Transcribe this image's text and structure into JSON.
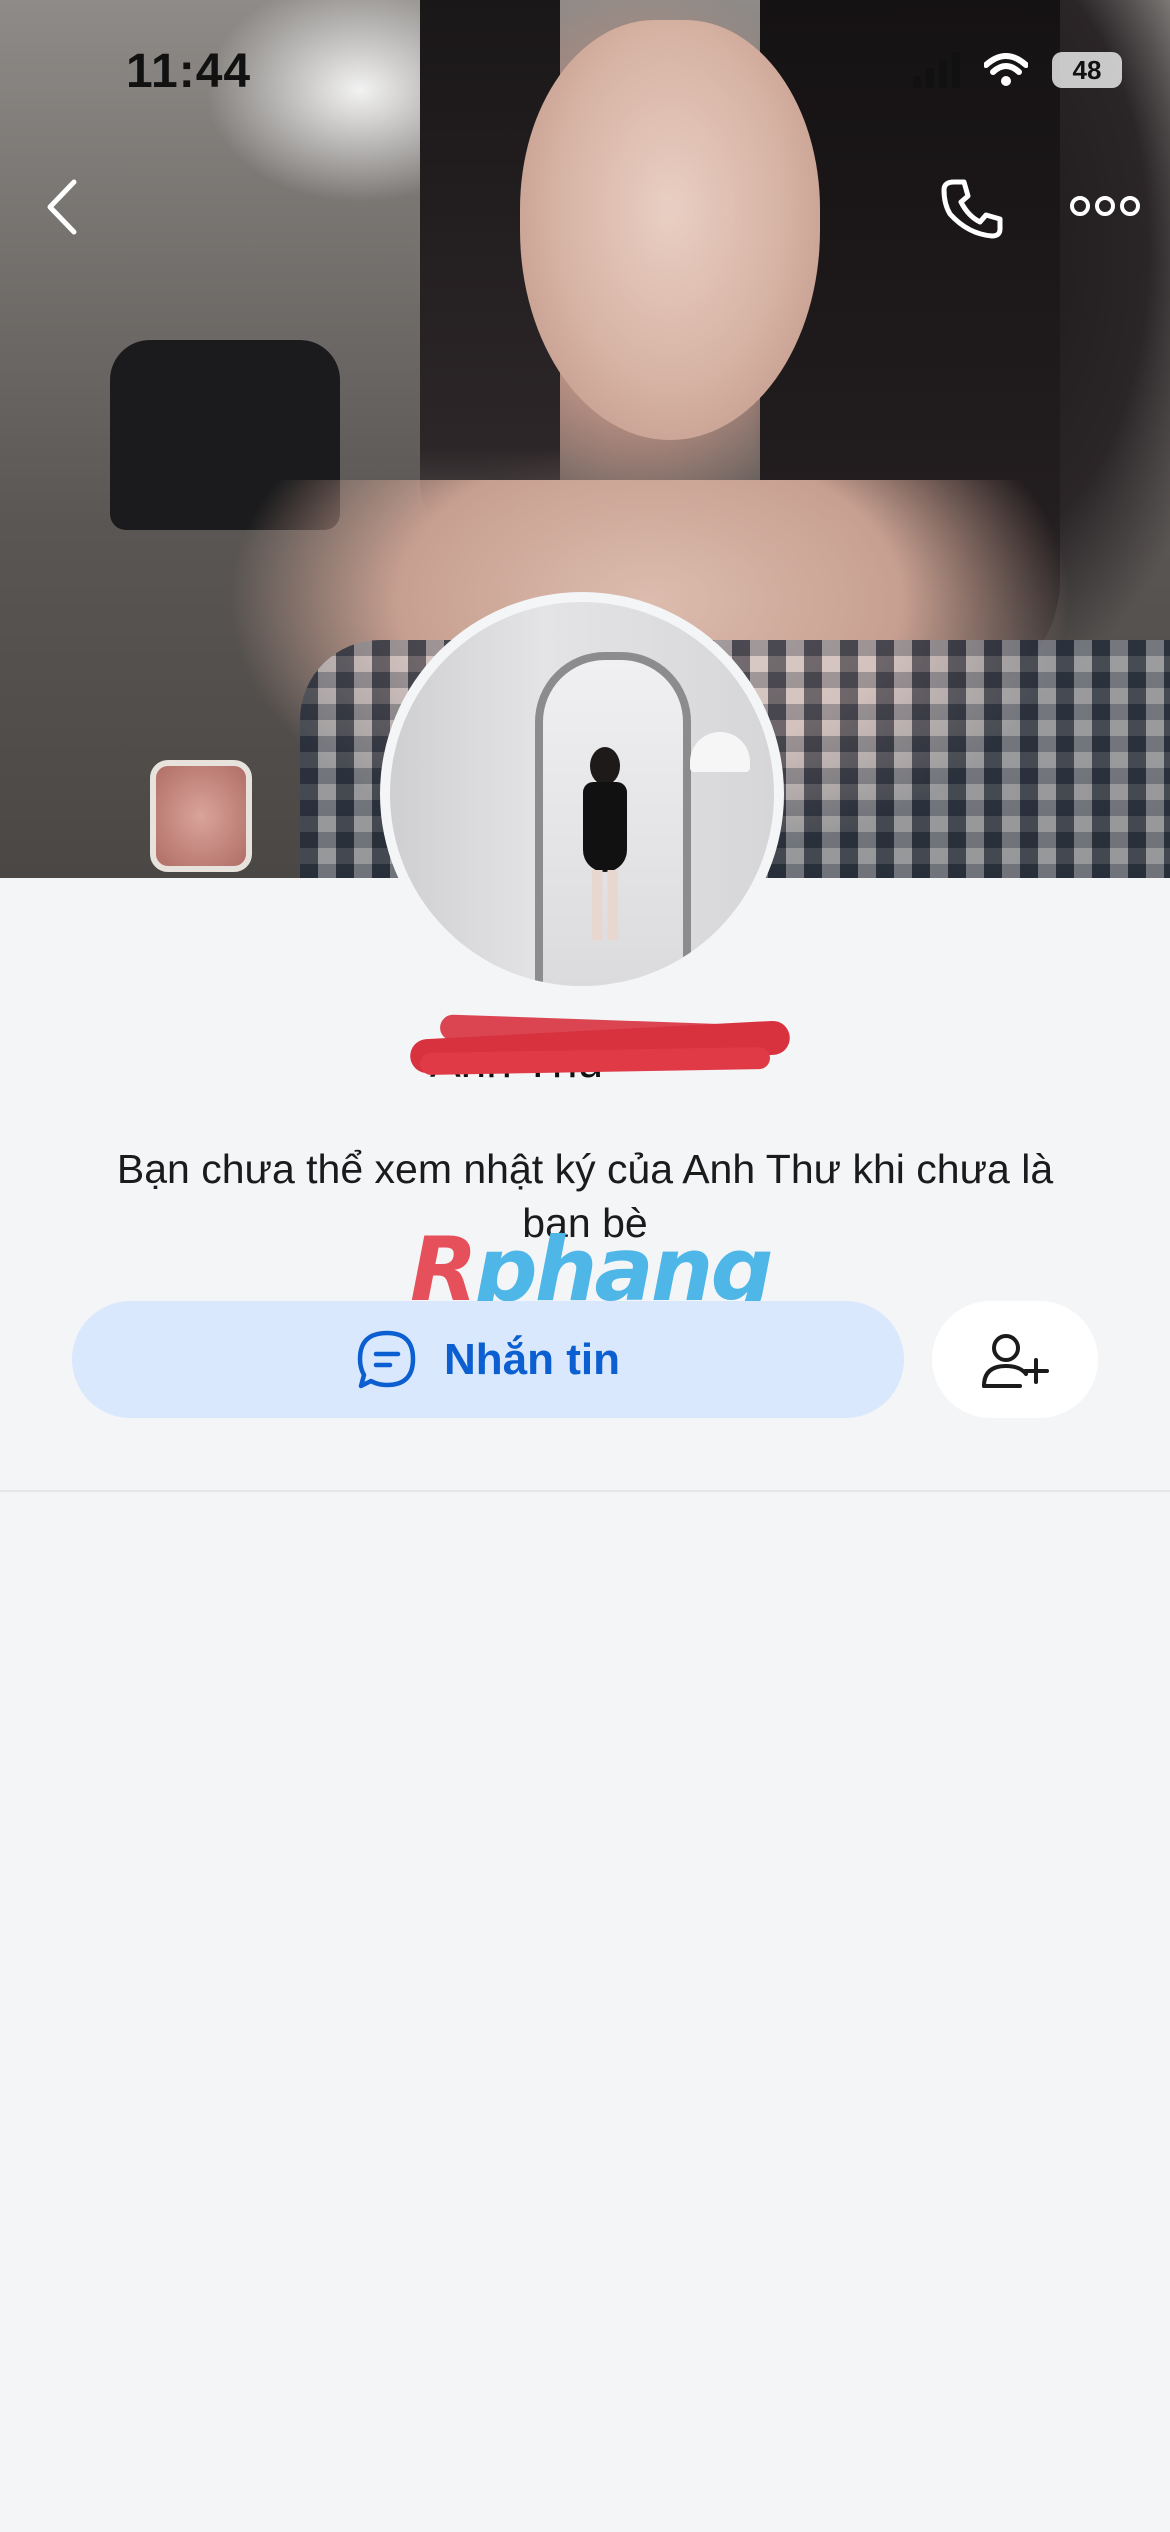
{
  "status_bar": {
    "time": "11:44",
    "battery": "48"
  },
  "profile": {
    "name": "Anh Thư",
    "notice": "Bạn chưa thể xem nhật ký của Anh Thư khi chưa là bạn bè"
  },
  "actions": {
    "message_label": "Nhắn tin"
  },
  "watermark": {
    "part_a": "R",
    "part_b": "phang"
  }
}
